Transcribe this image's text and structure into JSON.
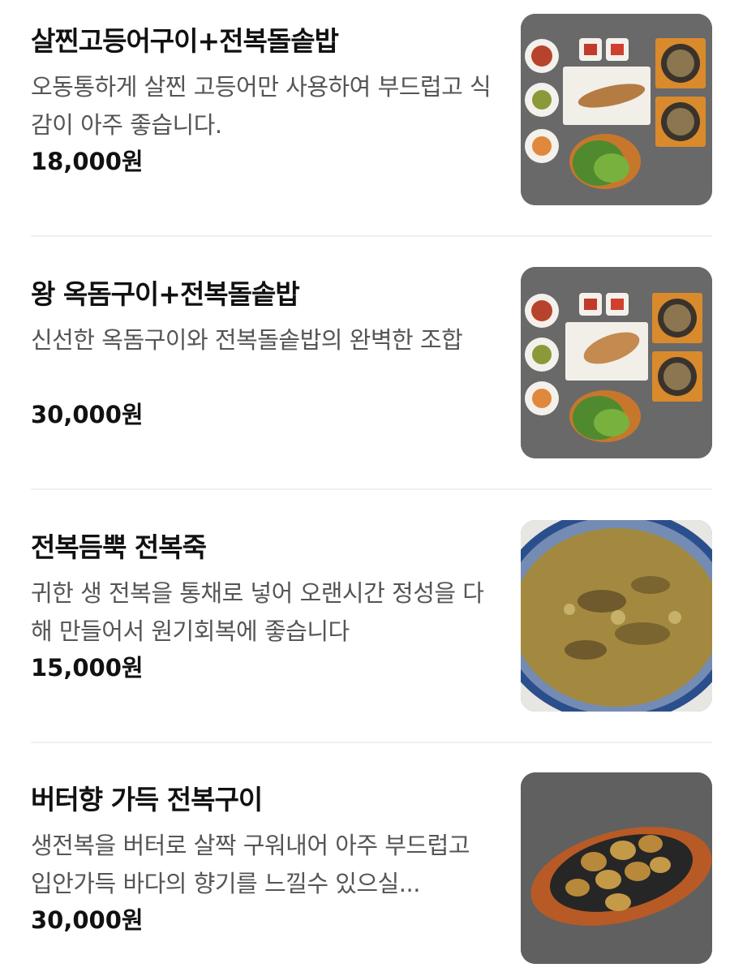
{
  "items": [
    {
      "name": "살찐고등어구이+전복돌솥밥",
      "desc": "오동통하게 살찐 고등어만 사용하여 부드럽고 식감이 아주 좋습니다.",
      "price": "18,000원",
      "image": "mackerel-set-photo"
    },
    {
      "name": "왕 옥돔구이+전복돌솥밥",
      "desc": "신선한 옥돔구이와 전복돌솥밥의 완벽한 조합",
      "price": "30,000원",
      "image": "tilefish-set-photo"
    },
    {
      "name": "전복듬뿍 전복죽",
      "desc": "귀한 생 전복을 통채로 넣어 오랜시간 정성을 다해 만들어서 원기회복에 좋습니다",
      "price": "15,000원",
      "image": "abalone-porridge-photo"
    },
    {
      "name": "버터향 가득 전복구이",
      "desc": "생전복을 버터로 살짝 구워내어 아주 부드럽고 입안가득 바다의 향기를 느낄수 있으실...",
      "price": "30,000원",
      "image": "grilled-abalone-photo"
    }
  ]
}
